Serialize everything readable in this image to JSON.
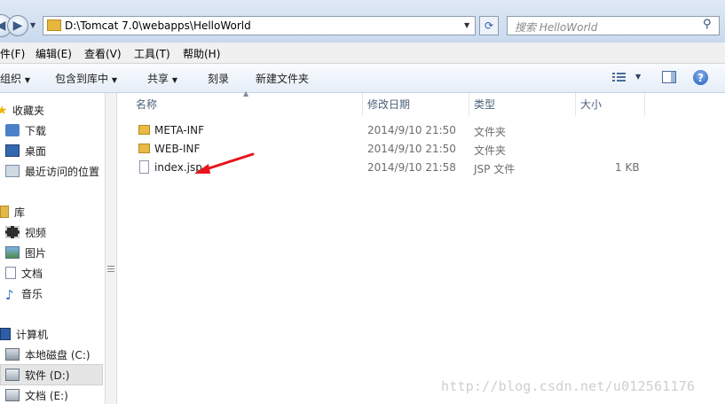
{
  "address": {
    "path": "D:\\Tomcat 7.0\\webapps\\HelloWorld",
    "search_placeholder": "搜索 HelloWorld"
  },
  "menu": [
    "件(F)",
    "编辑(E)",
    "查看(V)",
    "工具(T)",
    "帮助(H)"
  ],
  "toolbar": {
    "organize": "组织",
    "include": "包含到库中",
    "share": "共享",
    "burn": "刻录",
    "new_folder": "新建文件夹"
  },
  "columns": {
    "name": "名称",
    "modified": "修改日期",
    "type": "类型",
    "size": "大小"
  },
  "nav": {
    "favorites": "收藏夹",
    "downloads": "下载",
    "desktop": "桌面",
    "recent": "最近访问的位置",
    "libraries": "库",
    "videos": "视频",
    "pictures": "图片",
    "documents": "文档",
    "music": "音乐",
    "computer": "计算机",
    "drive_c": "本地磁盘 (C:)",
    "drive_d": "软件 (D:)",
    "drive_e": "文档 (E:)"
  },
  "files": [
    {
      "name": "META-INF",
      "modified": "2014/9/10 21:50",
      "type": "文件夹",
      "size": "",
      "icon": "folder-icon"
    },
    {
      "name": "WEB-INF",
      "modified": "2014/9/10 21:50",
      "type": "文件夹",
      "size": "",
      "icon": "folder-icon"
    },
    {
      "name": "index.jsp",
      "modified": "2014/9/10 21:58",
      "type": "JSP 文件",
      "size": "1 KB",
      "icon": "file-icon"
    }
  ],
  "watermark": "http://blog.csdn.net/u012561176",
  "colors": {
    "selection": "#cce8ff",
    "annotation_arrow": "#e8141b"
  }
}
